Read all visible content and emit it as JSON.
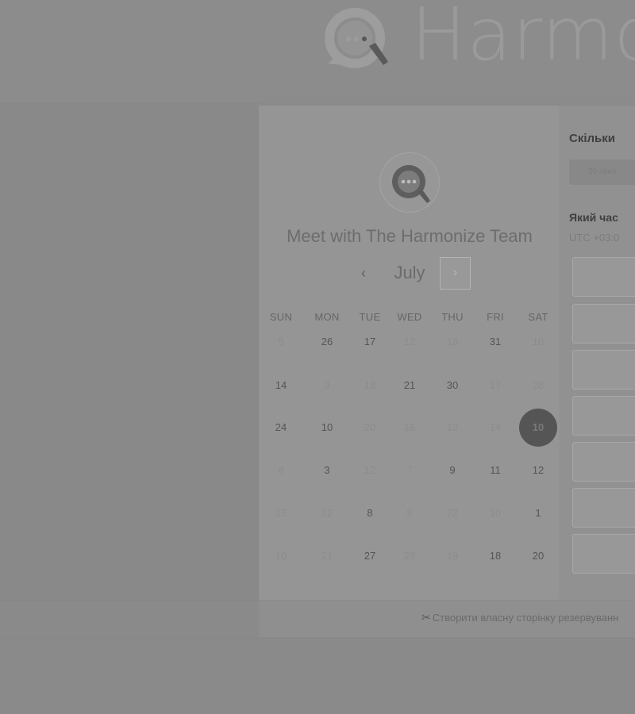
{
  "header": {
    "brand_text": "Harmo"
  },
  "booking": {
    "title": "Meet with The Harmonize Team",
    "month": "July",
    "prev_icon": "‹",
    "next_icon": "›",
    "weekdays": [
      "SUN",
      "MON",
      "TUE",
      "WED",
      "THU",
      "FRI",
      "SAT"
    ],
    "weeks": [
      [
        {
          "n": "5",
          "a": false
        },
        {
          "n": "26",
          "a": true
        },
        {
          "n": "17",
          "a": true
        },
        {
          "n": "12",
          "a": false
        },
        {
          "n": "18",
          "a": false
        },
        {
          "n": "31",
          "a": true
        },
        {
          "n": "10",
          "a": false
        }
      ],
      [
        {
          "n": "14",
          "a": true
        },
        {
          "n": "3",
          "a": false
        },
        {
          "n": "18",
          "a": false
        },
        {
          "n": "21",
          "a": true
        },
        {
          "n": "30",
          "a": true
        },
        {
          "n": "17",
          "a": false
        },
        {
          "n": "28",
          "a": false
        }
      ],
      [
        {
          "n": "24",
          "a": true
        },
        {
          "n": "10",
          "a": true
        },
        {
          "n": "20",
          "a": false
        },
        {
          "n": "16",
          "a": false
        },
        {
          "n": "12",
          "a": false
        },
        {
          "n": "14",
          "a": false
        },
        {
          "n": "10",
          "a": true,
          "selected": true
        }
      ],
      [
        {
          "n": "8",
          "a": false
        },
        {
          "n": "3",
          "a": true
        },
        {
          "n": "12",
          "a": false
        },
        {
          "n": "7",
          "a": false
        },
        {
          "n": "9",
          "a": true
        },
        {
          "n": "11",
          "a": true
        },
        {
          "n": "12",
          "a": true
        }
      ],
      [
        {
          "n": "15",
          "a": false
        },
        {
          "n": "12",
          "a": false
        },
        {
          "n": "8",
          "a": true
        },
        {
          "n": "9",
          "a": false
        },
        {
          "n": "22",
          "a": false
        },
        {
          "n": "10",
          "a": false
        },
        {
          "n": "1",
          "a": true
        }
      ],
      [
        {
          "n": "10",
          "a": false
        },
        {
          "n": "21",
          "a": false
        },
        {
          "n": "27",
          "a": true
        },
        {
          "n": "28",
          "a": false
        },
        {
          "n": "19",
          "a": false
        },
        {
          "n": "18",
          "a": true
        },
        {
          "n": "20",
          "a": true
        }
      ]
    ],
    "duration_label": "Скільки",
    "duration_value": "30 хвил",
    "time_label": "Який час",
    "timezone": "UTC +03:0"
  },
  "footer": {
    "link": "Створити власну сторінку резервуванн"
  },
  "colors": {
    "overlay": "#8a8a8a",
    "selected_day": "#555555"
  }
}
